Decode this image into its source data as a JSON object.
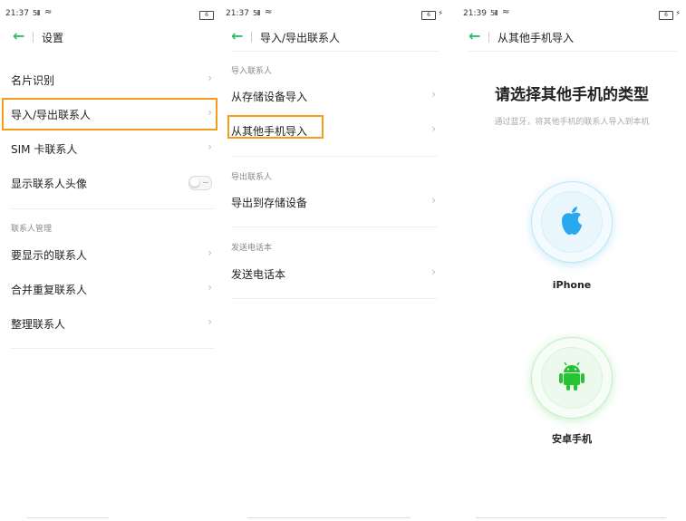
{
  "panel1": {
    "status": {
      "time": "21:37",
      "signal": "5ill",
      "battery": "6"
    },
    "title": "设置",
    "items": [
      {
        "label": "名片识别"
      },
      {
        "label": "导入/导出联系人"
      },
      {
        "label": "SIM 卡联系人"
      },
      {
        "label": "显示联系人头像"
      }
    ],
    "section_manage": "联系人管理",
    "manage_items": [
      {
        "label": "要显示的联系人"
      },
      {
        "label": "合并重复联系人"
      },
      {
        "label": "整理联系人"
      }
    ]
  },
  "panel2": {
    "status": {
      "time": "21:37",
      "signal": "5ill",
      "battery": "6"
    },
    "title": "导入/导出联系人",
    "section_import": "导入联系人",
    "import_items": [
      {
        "label": "从存储设备导入"
      },
      {
        "label": "从其他手机导入"
      }
    ],
    "section_export": "导出联系人",
    "export_items": [
      {
        "label": "导出到存储设备"
      }
    ],
    "section_send": "发送电话本",
    "send_items": [
      {
        "label": "发送电话本"
      }
    ]
  },
  "panel3": {
    "status": {
      "time": "21:39",
      "signal": "5ill",
      "battery": "6"
    },
    "title": "从其他手机导入",
    "heading": "请选择其他手机的类型",
    "subheading": "通过蓝牙，将其他手机的联系人导入到本机",
    "options": [
      {
        "label": "iPhone",
        "icon": "apple-icon",
        "color": "#29a8f0"
      },
      {
        "label": "安卓手机",
        "icon": "android-icon",
        "color": "#26c433"
      }
    ]
  },
  "colors": {
    "accent": "#2dbd6e",
    "highlight": "#f59d1b"
  }
}
